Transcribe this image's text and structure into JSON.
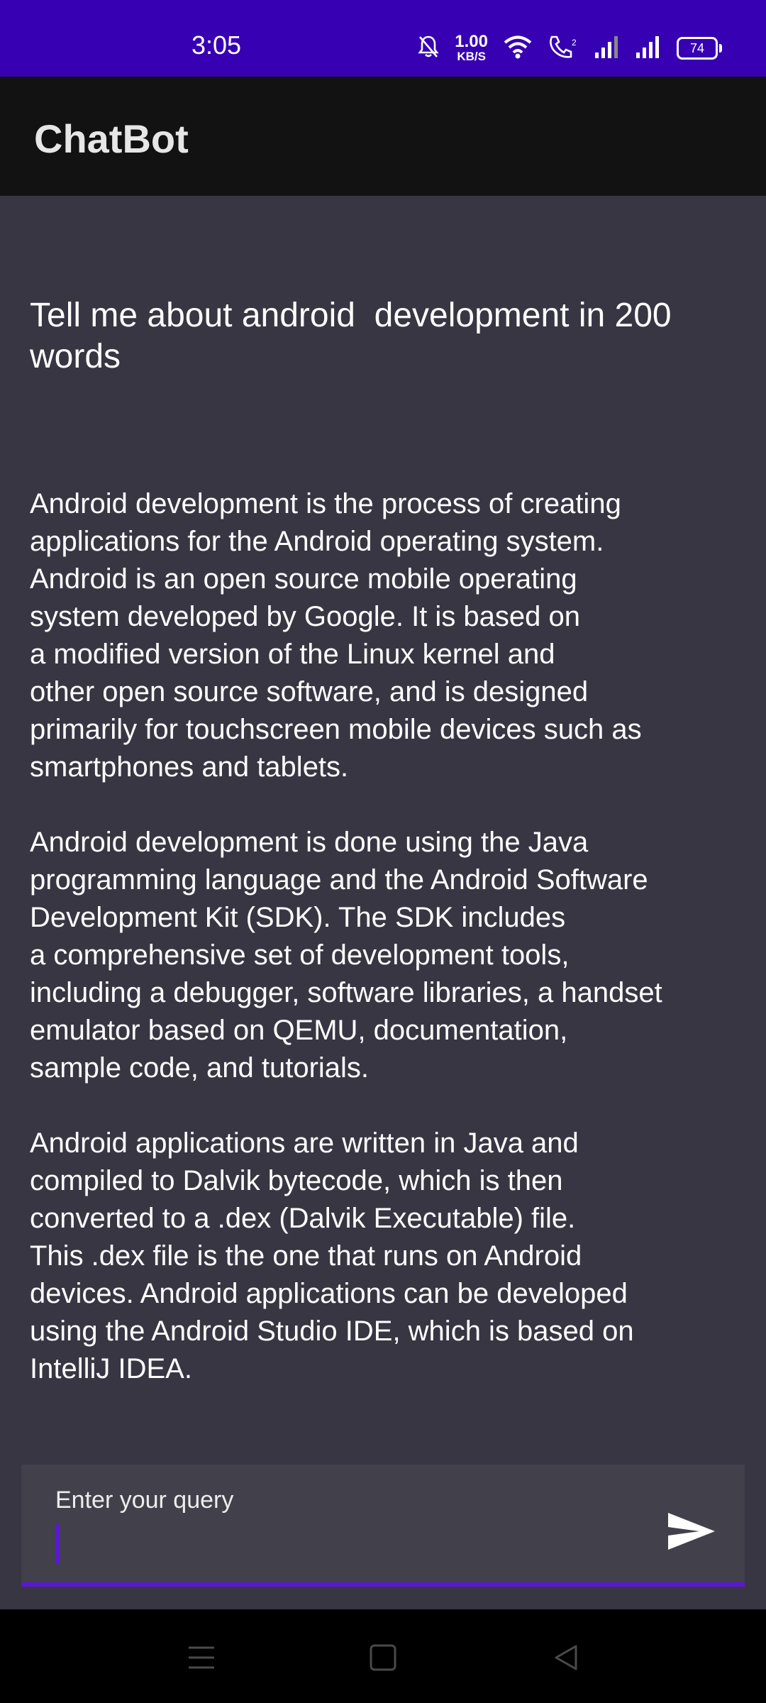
{
  "status_bar": {
    "time": "3:05",
    "net_speed_value": "1.00",
    "net_speed_unit": "KB/S",
    "battery_level": "74",
    "icons": [
      "mute-icon",
      "wifi-icon",
      "volte-call-icon",
      "signal-icon",
      "signal-icon",
      "battery-icon"
    ]
  },
  "app_bar": {
    "title": "ChatBot"
  },
  "chat": {
    "query": "Tell me about android  development in 200 words",
    "response": "Android development is the process of creating\napplications for the Android operating system.\nAndroid is an open source mobile operating\nsystem developed by Google. It is based on\na modified version of the Linux kernel and\nother open source software, and is designed\nprimarily for touchscreen mobile devices such as\nsmartphones and tablets.\n\nAndroid development is done using the Java\nprogramming language and the Android Software\nDevelopment Kit (SDK). The SDK includes\na comprehensive set of development tools,\nincluding a debugger, software libraries, a handset\nemulator based on QEMU, documentation,\nsample code, and tutorials.\n\nAndroid applications are written in Java and\ncompiled to Dalvik bytecode, which is then\nconverted to a .dex (Dalvik Executable) file.\nThis .dex file is the one that runs on Android\ndevices. Android applications can be developed\nusing the Android Studio IDE, which is based on\nIntelliJ IDEA."
  },
  "input": {
    "label": "Enter your query",
    "value": "",
    "send_icon": "send-icon",
    "accent_color": "#5B17D6"
  },
  "nav_bar": {
    "icons": [
      "menu-icon",
      "home-icon",
      "back-icon"
    ]
  },
  "colors": {
    "status_bar": "#3700B3",
    "app_bar": "#121212",
    "background": "#383643",
    "input_background": "#42404B"
  }
}
